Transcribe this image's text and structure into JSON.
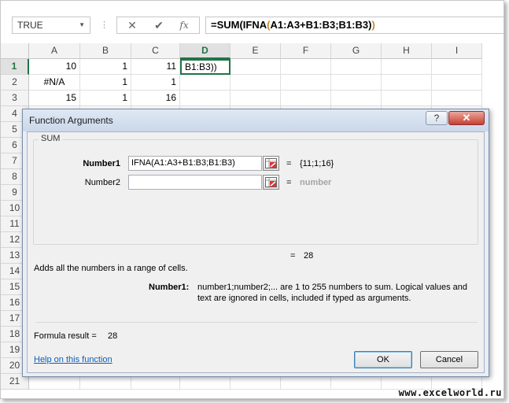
{
  "formula_bar": {
    "name_box": "TRUE",
    "cancel_icon": "✕",
    "enter_icon": "✔",
    "fx_label": "fx",
    "formula_prefix": "=SUM(IFNA",
    "formula_paren": "(",
    "formula_rest": "A1:A3+B1:B3;B1:B3)",
    "formula_close": ")"
  },
  "columns": [
    "A",
    "B",
    "C",
    "D",
    "E",
    "F",
    "G",
    "H",
    "I"
  ],
  "rows": [
    "1",
    "2",
    "3",
    "4",
    "5",
    "6",
    "7",
    "8",
    "9",
    "10",
    "11",
    "12",
    "13",
    "14",
    "15",
    "16",
    "17",
    "18",
    "19",
    "20",
    "21"
  ],
  "cells": {
    "A1": "10",
    "B1": "1",
    "C1": "11",
    "D1": "B1:B3))",
    "A2": "#N/A",
    "B2": "1",
    "C2": "1",
    "A3": "15",
    "B3": "1",
    "C3": "16"
  },
  "dialog": {
    "title": "Function Arguments",
    "help_label": "?",
    "close_label": "✕",
    "function_name": "SUM",
    "arg1_label": "Number1",
    "arg1_value": "IFNA(A1:A3+B1:B3;B1:B3)",
    "arg1_result": "{11;1;16}",
    "arg2_label": "Number2",
    "arg2_value": "",
    "arg2_result": "number",
    "equals": "=",
    "total_result": "28",
    "description": "Adds all the numbers in a range of cells.",
    "arg_help_label": "Number1:",
    "arg_help_line1": "number1;number2;... are 1 to 255 numbers to sum. Logical values and",
    "arg_help_line2": "text are ignored in cells, included if typed as arguments.",
    "formula_result_label": "Formula result =",
    "formula_result_value": "28",
    "help_link": "Help on this function",
    "ok_label": "OK",
    "cancel_label": "Cancel"
  },
  "watermark": "www.excelworld.ru",
  "colors": {
    "accent": "#217346",
    "link": "#0b5fb6"
  }
}
